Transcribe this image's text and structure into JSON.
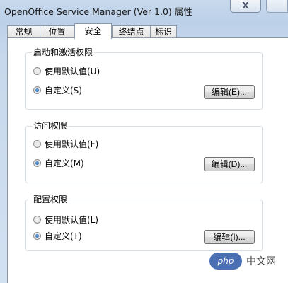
{
  "window": {
    "title": "OpenOffice Service Manager (Ver 1.0) 属性",
    "close_glyph": "X"
  },
  "tabs": [
    {
      "label": "常规"
    },
    {
      "label": "位置"
    },
    {
      "label": "安全",
      "active": true
    },
    {
      "label": "终结点"
    },
    {
      "label": "标识"
    }
  ],
  "groups": [
    {
      "title": "启动和激活权限",
      "option_default": "使用默认值(U)",
      "option_custom": "自定义(S)",
      "selected": "custom",
      "edit_label": "编辑(E)..."
    },
    {
      "title": "访问权限",
      "option_default": "使用默认值(F)",
      "option_custom": "自定义(M)",
      "selected": "custom",
      "edit_label": "编辑(D)..."
    },
    {
      "title": "配置权限",
      "option_default": "使用默认值(L)",
      "option_custom": "自定义(T)",
      "selected": "custom",
      "edit_label": "编辑(I)..."
    }
  ],
  "watermark": {
    "badge": "php",
    "text": "中文网"
  },
  "colors": {
    "radio_selected": "#1f5aa3",
    "watermark_badge": "#4b6fb3"
  }
}
